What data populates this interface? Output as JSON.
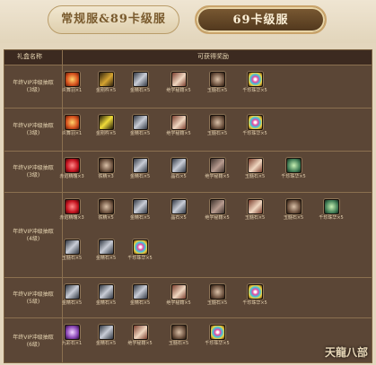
{
  "tabs": [
    {
      "label": "常规服&89卡级服",
      "active": false
    },
    {
      "label": "69卡级服",
      "active": true
    }
  ],
  "table": {
    "col_name_header": "礼盒名称",
    "col_rewards_header": "可获得奖励"
  },
  "brand_logo": "天龍八部",
  "rows": [
    {
      "name": "年终VIP冲级抽取",
      "name2": "(3级)",
      "items": [
        {
          "label": "炎舞羽×1",
          "icon": "c-orange"
        },
        {
          "label": "金刚杵×5",
          "icon": "c-gold"
        },
        {
          "label": "金精石×5",
          "icon": "c-steel"
        },
        {
          "label": "绝学秘籍×5",
          "icon": "c-book"
        },
        {
          "label": "玉髓石×5",
          "icon": "c-ore"
        },
        {
          "label": "千珍珠华×5",
          "icon": "c-rainbow"
        }
      ]
    },
    {
      "name": "年终VIP冲级抽取",
      "name2": "(3级)",
      "items": [
        {
          "label": "炎舞羽×1",
          "icon": "c-orange"
        },
        {
          "label": "金刚杵×5",
          "icon": "c-yellow"
        },
        {
          "label": "金精石×5",
          "icon": "c-steel"
        },
        {
          "label": "绝学秘籍×5",
          "icon": "c-book"
        },
        {
          "label": "玉髓石×5",
          "icon": "c-ore"
        },
        {
          "label": "千珍珠华×5",
          "icon": "c-rainbow"
        }
      ]
    },
    {
      "name": "年终VIP冲级抽取",
      "name2": "(3级)",
      "items": [
        {
          "label": "赤焰精魄×3",
          "icon": "c-red"
        },
        {
          "label": "铁精×3",
          "icon": "c-ore"
        },
        {
          "label": "金精石×5",
          "icon": "c-steel"
        },
        {
          "label": "晶石×5",
          "icon": "c-steel"
        },
        {
          "label": "绝学秘籍×5",
          "icon": "c-slab"
        },
        {
          "label": "玉髓石×5",
          "icon": "c-book"
        },
        {
          "label": "千珍珠华×5",
          "icon": "c-jade"
        }
      ]
    },
    {
      "name": "年终VIP冲级抽取",
      "name2": "(4级)",
      "items": [
        {
          "label": "赤焰精魄×3",
          "icon": "c-red"
        },
        {
          "label": "铁精×5",
          "icon": "c-ore"
        },
        {
          "label": "金精石×5",
          "icon": "c-steel"
        },
        {
          "label": "晶石×5",
          "icon": "c-steel"
        },
        {
          "label": "绝学秘籍×5",
          "icon": "c-slab"
        },
        {
          "label": "玉髓石×5",
          "icon": "c-book"
        },
        {
          "label": "玉髓石×5",
          "icon": "c-ore"
        },
        {
          "label": "千珍珠华×5",
          "icon": "c-jade"
        },
        {
          "label": "玉髓石×5",
          "icon": "c-steel"
        },
        {
          "label": "金精石×5",
          "icon": "c-steel"
        },
        {
          "label": "千珍珠华×5",
          "icon": "c-rainbow"
        }
      ]
    },
    {
      "name": "年终VIP冲级抽取",
      "name2": "(5级)",
      "items": [
        {
          "label": "金精石×5",
          "icon": "c-steel"
        },
        {
          "label": "金精石×5",
          "icon": "c-steel"
        },
        {
          "label": "金精石×5",
          "icon": "c-steel"
        },
        {
          "label": "绝学秘籍×5",
          "icon": "c-book"
        },
        {
          "label": "玉髓石×5",
          "icon": "c-ore"
        },
        {
          "label": "千珍珠华×5",
          "icon": "c-rainbow"
        }
      ]
    },
    {
      "name": "年终VIP冲级抽取",
      "name2": "(6级)",
      "items": [
        {
          "label": "九彩石×1",
          "icon": "c-purple"
        },
        {
          "label": "金精石×5",
          "icon": "c-steel"
        },
        {
          "label": "绝学秘籍×5",
          "icon": "c-book"
        },
        {
          "label": "玉髓石×5",
          "icon": "c-ore"
        },
        {
          "label": "千珍珠华×5",
          "icon": "c-rainbow"
        }
      ]
    }
  ]
}
